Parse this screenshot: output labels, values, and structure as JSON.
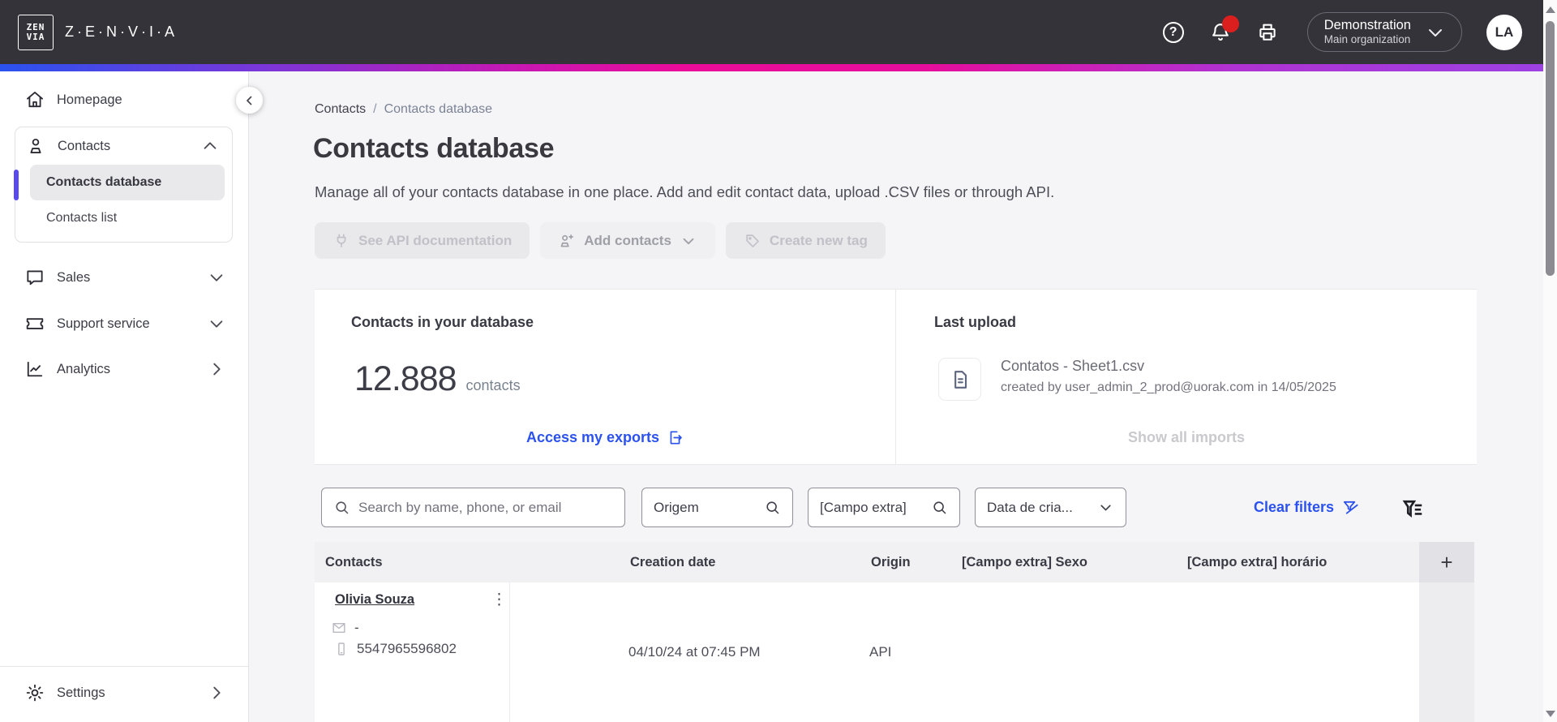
{
  "header": {
    "logo_mark_top": "ZEN",
    "logo_mark_bottom": "VIA",
    "logo_text": "Z·E·N·V·I·A",
    "help_glyph": "?",
    "org": {
      "name": "Demonstration",
      "sub": "Main organization"
    },
    "avatar_initials": "LA"
  },
  "sidebar": {
    "items": [
      {
        "label": "Homepage"
      },
      {
        "label": "Contacts"
      },
      {
        "label": "Contacts database"
      },
      {
        "label": "Contacts list"
      },
      {
        "label": "Sales"
      },
      {
        "label": "Support service"
      },
      {
        "label": "Analytics"
      },
      {
        "label": "Settings"
      }
    ]
  },
  "breadcrumb": {
    "items": [
      "Contacts",
      "Contacts database"
    ],
    "separator": "/"
  },
  "page": {
    "title": "Contacts database",
    "subtitle": "Manage all of your contacts database in one place. Add and edit contact data, upload .CSV files or through API."
  },
  "actions": {
    "see_api": "See API documentation",
    "add_contacts": "Add contacts",
    "create_tag": "Create new tag"
  },
  "cards": {
    "contacts_count": {
      "title": "Contacts in your database",
      "count": "12.888",
      "unit": "contacts",
      "link": "Access my exports"
    },
    "last_upload": {
      "title": "Last upload",
      "file": "Contatos - Sheet1.csv",
      "meta": "created by user_admin_2_prod@uorak.com in 14/05/2025",
      "link": "Show all imports"
    }
  },
  "filters": {
    "search_placeholder": "Search by name, phone, or email",
    "origem": "Origem",
    "campo_extra": "[Campo extra]",
    "data_de": "Data de cria...",
    "clear": "Clear filters"
  },
  "table": {
    "columns": [
      "Contacts",
      "Creation date",
      "Origin",
      "[Campo extra] Sexo",
      "[Campo extra] horário"
    ],
    "add_column_glyph": "+",
    "kebab_glyph": "⋮",
    "rows": [
      {
        "name": "Olivia Souza",
        "email": "-",
        "phone": "5547965596802",
        "creation_date": "04/10/24 at 07:45 PM",
        "origin": "API"
      }
    ]
  },
  "colors": {
    "topbar": "#343339",
    "accent_blue": "#2b52ee",
    "active_indicator": "#5b49f0",
    "notification_red": "#db1f1f",
    "gradient": [
      "#2a52ee",
      "#c518b4",
      "#ea0b9b",
      "#9d41e2"
    ]
  }
}
